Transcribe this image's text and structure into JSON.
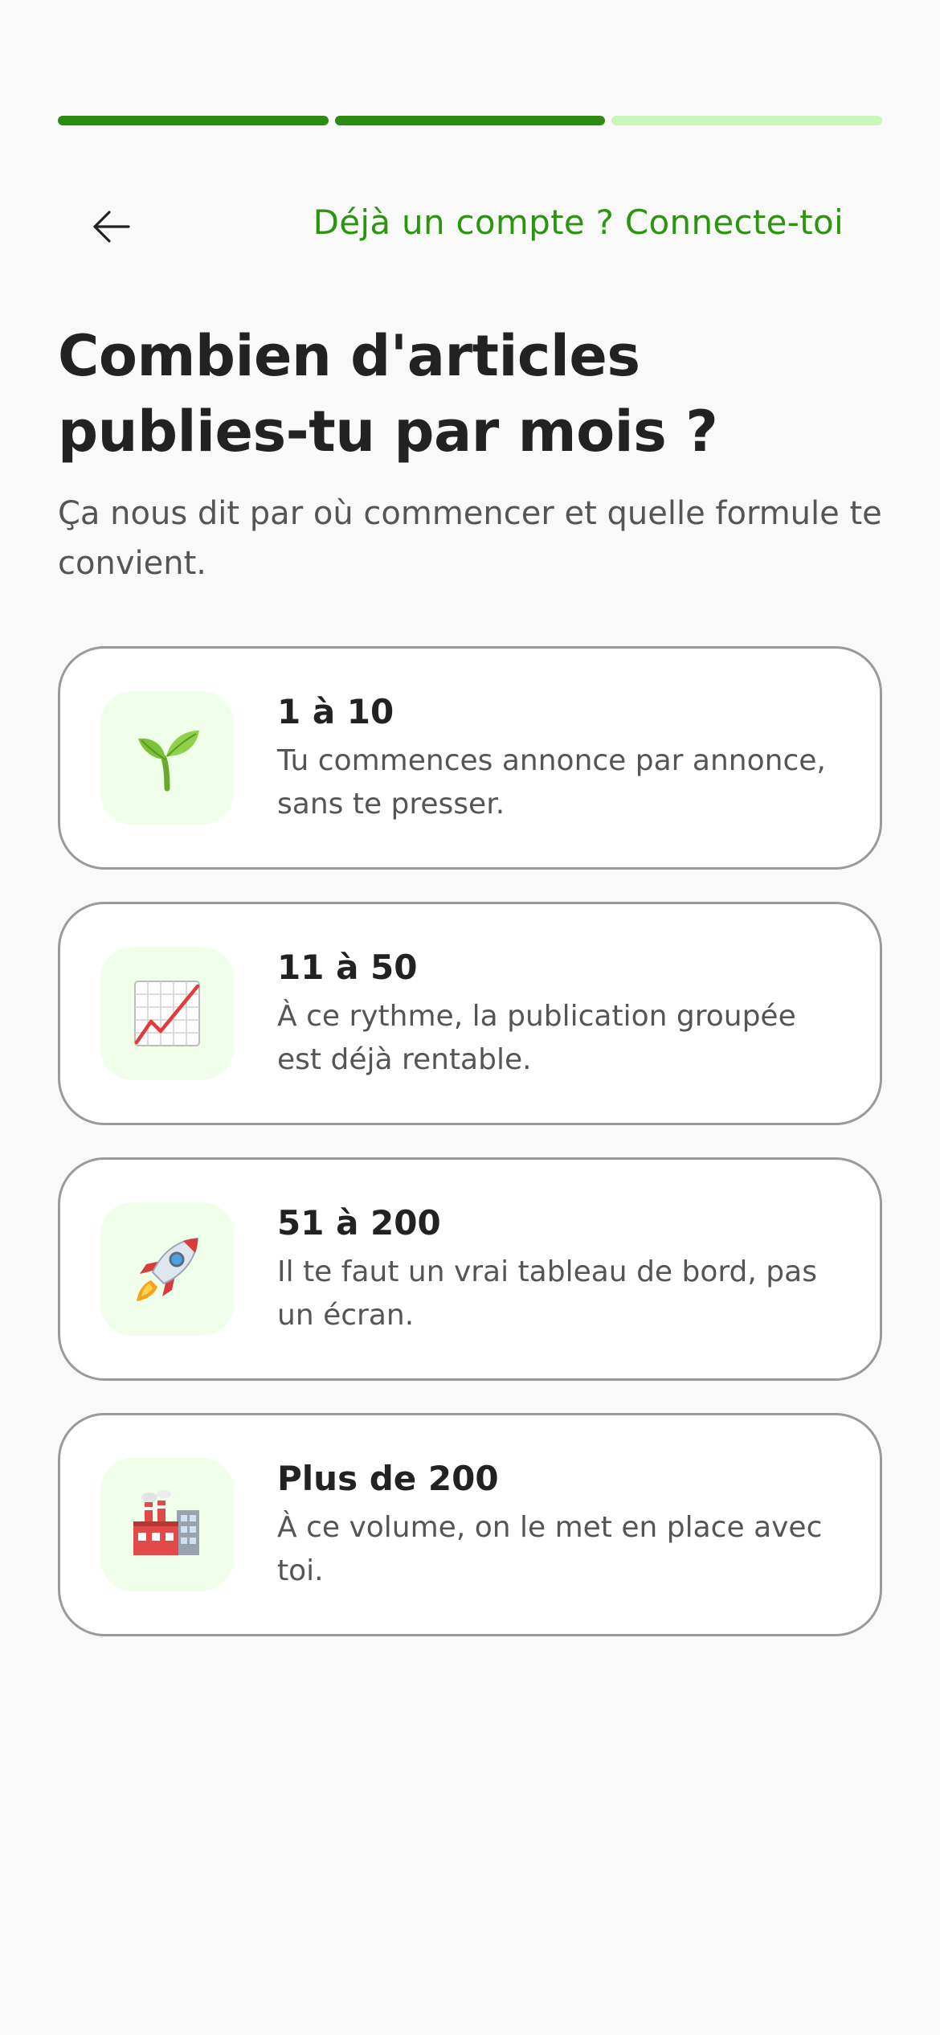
{
  "progress": {
    "total_steps": 3,
    "completed_steps": 2,
    "colors": {
      "done": "#2b8c0f",
      "todo": "#c8f7b9"
    }
  },
  "header": {
    "back_icon": "arrow-left-icon",
    "login_link": "Déjà un compte ? Connecte-toi",
    "accent_color": "#2b9510"
  },
  "question": {
    "title": "Combien d'articles publies-tu par mois ?",
    "subtitle": "Ça nous dit par où commencer et quelle formule te convient."
  },
  "options": [
    {
      "icon": "seedling-icon",
      "title": "1 à 10",
      "description": "Tu commences annonce par annonce, sans te presser."
    },
    {
      "icon": "chart-increasing-icon",
      "title": "11 à 50",
      "description": "À ce rythme, la publication groupée est déjà rentable."
    },
    {
      "icon": "rocket-icon",
      "title": "51 à 200",
      "description": "Il te faut un vrai tableau de bord, pas un écran."
    },
    {
      "icon": "factory-icon",
      "title": "Plus de 200",
      "description": "À ce volume, on le met en place avec toi."
    }
  ]
}
